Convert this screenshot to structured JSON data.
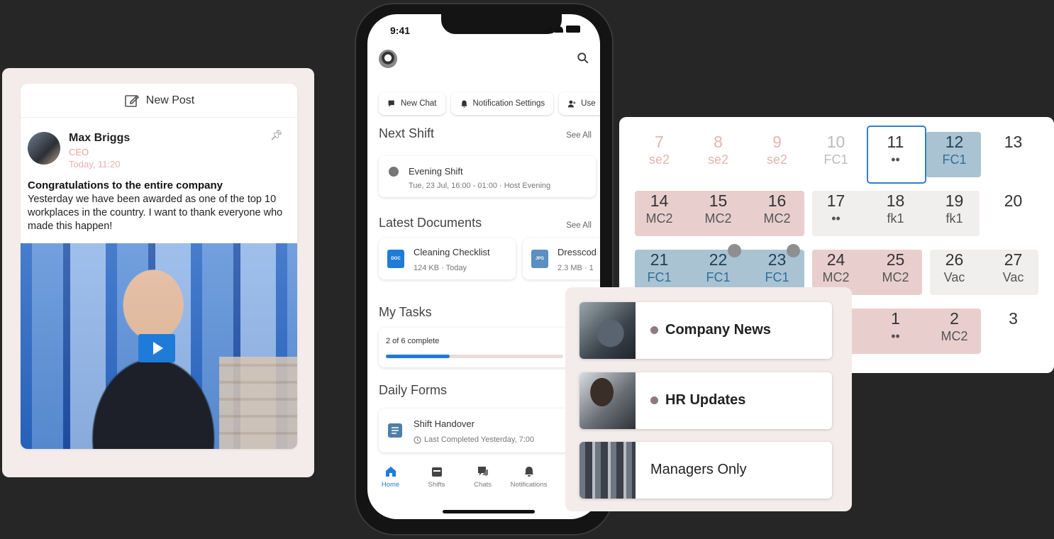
{
  "post": {
    "new_post_label": "New Post",
    "author_name": "Max Briggs",
    "author_role": "CEO",
    "timestamp": "Today, 11:20",
    "title": "Congratulations to the entire company",
    "body": "Yesterday we have been awarded as one of the top 10 workplaces in the country. I want to thank everyone who made this happen!"
  },
  "phone": {
    "status_time": "9:41",
    "quick_actions": [
      "New Chat",
      "Notification Settings",
      "Use"
    ],
    "next_shift": {
      "heading": "Next Shift",
      "see_all": "See All",
      "shift_name": "Evening Shift",
      "shift_detail": "Tue, 23 Jul, 16:00 - 01:00 · Host Evening"
    },
    "documents": {
      "heading": "Latest Documents",
      "see_all": "See All",
      "items": [
        {
          "badge": "DOC",
          "name": "Cleaning Checklist",
          "meta": "124 KB · Today",
          "color": "#1f7bd8"
        },
        {
          "badge": "JPG",
          "name": "Dresscod",
          "meta": "2.3 MB · 1",
          "color": "#5a8fc0"
        }
      ]
    },
    "tasks": {
      "heading": "My Tasks",
      "progress_label": "2 of 6 complete",
      "progress_fraction": 0.36
    },
    "forms": {
      "heading": "Daily Forms",
      "form_name": "Shift Handover",
      "form_meta": "Last Completed Yesterday, 7:00"
    },
    "tabs": [
      "Home",
      "Shifts",
      "Chats",
      "Notifications"
    ]
  },
  "calendar": {
    "rows": [
      [
        {
          "n": "7",
          "c": "se2"
        },
        {
          "n": "8",
          "c": "se2"
        },
        {
          "n": "9",
          "c": "se2"
        },
        {
          "n": "10",
          "c": "FC1"
        },
        {
          "n": "11",
          "c": "••"
        },
        {
          "n": "12",
          "c": "FC1"
        },
        {
          "n": "13",
          "c": ""
        }
      ],
      [
        {
          "n": "14",
          "c": "MC2"
        },
        {
          "n": "15",
          "c": "MC2"
        },
        {
          "n": "16",
          "c": "MC2"
        },
        {
          "n": "17",
          "c": "••"
        },
        {
          "n": "18",
          "c": "fk1"
        },
        {
          "n": "19",
          "c": "fk1"
        },
        {
          "n": "20",
          "c": ""
        }
      ],
      [
        {
          "n": "21",
          "c": "FC1"
        },
        {
          "n": "22",
          "c": "FC1"
        },
        {
          "n": "23",
          "c": "FC1"
        },
        {
          "n": "24",
          "c": "MC2"
        },
        {
          "n": "25",
          "c": "MC2"
        },
        {
          "n": "26",
          "c": "Vac"
        },
        {
          "n": "27",
          "c": "Vac"
        }
      ],
      [
        {
          "n": "",
          "c": ""
        },
        {
          "n": "",
          "c": ""
        },
        {
          "n": "",
          "c": ""
        },
        {
          "n": "",
          "c": ""
        },
        {
          "n": "1",
          "c": "••"
        },
        {
          "n": "2",
          "c": "MC2"
        },
        {
          "n": "3",
          "c": ""
        }
      ]
    ],
    "colors": {
      "pink": "#e8cfcd",
      "blue": "#a9c3d2",
      "grey": "#f1eeee",
      "faded_text": "#e3b5b0"
    }
  },
  "channels": {
    "items": [
      {
        "label": "Company News",
        "unread": true
      },
      {
        "label": "HR Updates",
        "unread": true
      },
      {
        "label": "Managers Only",
        "unread": false
      }
    ]
  }
}
